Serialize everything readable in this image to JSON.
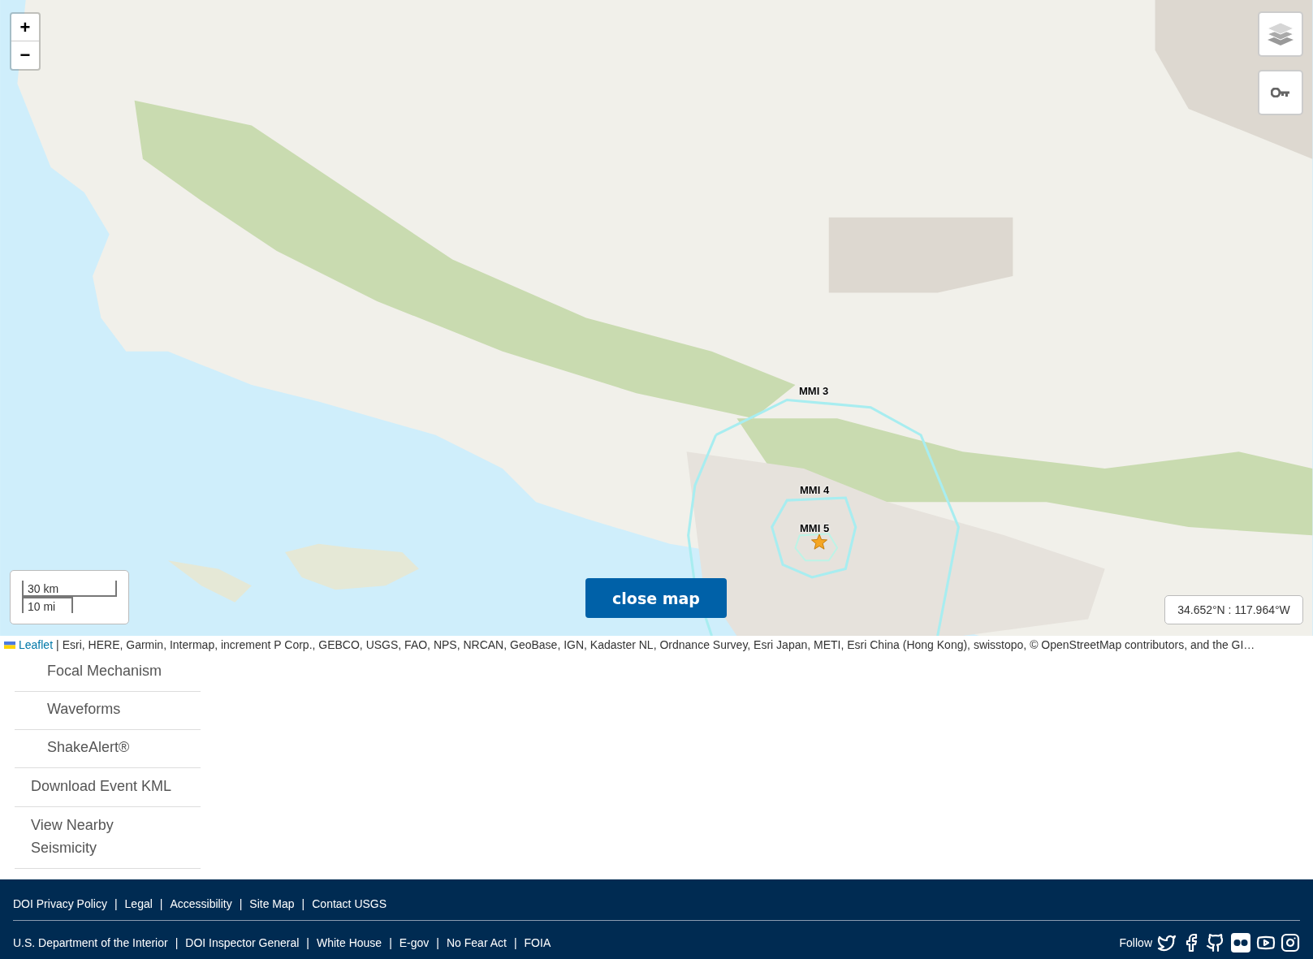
{
  "map": {
    "zoom_in": "+",
    "zoom_out": "−",
    "scale": {
      "metric": "30 km",
      "imperial": "10 mi"
    },
    "intensity_labels": [
      {
        "label": "MMI 3"
      },
      {
        "label": "MMI 4"
      },
      {
        "label": "MMI 5"
      }
    ],
    "close_button": "close map",
    "coordinates": "34.652°N : 117.964°W",
    "attribution": {
      "link": "Leaflet",
      "separator": "|",
      "text": "Esri, HERE, Garmin, Intermap, increment P Corp., GEBCO, USGS, FAO, NPS, NRCAN, GeoBase, IGN, Kadaster NL, Ordnance Survey, Esri Japan, METI, Esri China (Hong Kong), swisstopo, © OpenStreetMap contributors, and the GI…"
    }
  },
  "sidebar": {
    "items": [
      {
        "label": "Focal Mechanism",
        "kind": "sub"
      },
      {
        "label": "Waveforms",
        "kind": "sub"
      },
      {
        "label": "ShakeAlert®",
        "kind": "sub"
      },
      {
        "label": "Download Event KML",
        "kind": "main"
      },
      {
        "label": "View Nearby Seismicity",
        "kind": "main"
      }
    ]
  },
  "footer": {
    "links_top": [
      "DOI Privacy Policy",
      "Legal",
      "Accessibility",
      "Site Map",
      "Contact USGS"
    ],
    "links_bottom": [
      "U.S. Department of the Interior",
      "DOI Inspector General",
      "White House",
      "E-gov",
      "No Fear Act",
      "FOIA"
    ],
    "separator": "|",
    "follow": "Follow"
  }
}
